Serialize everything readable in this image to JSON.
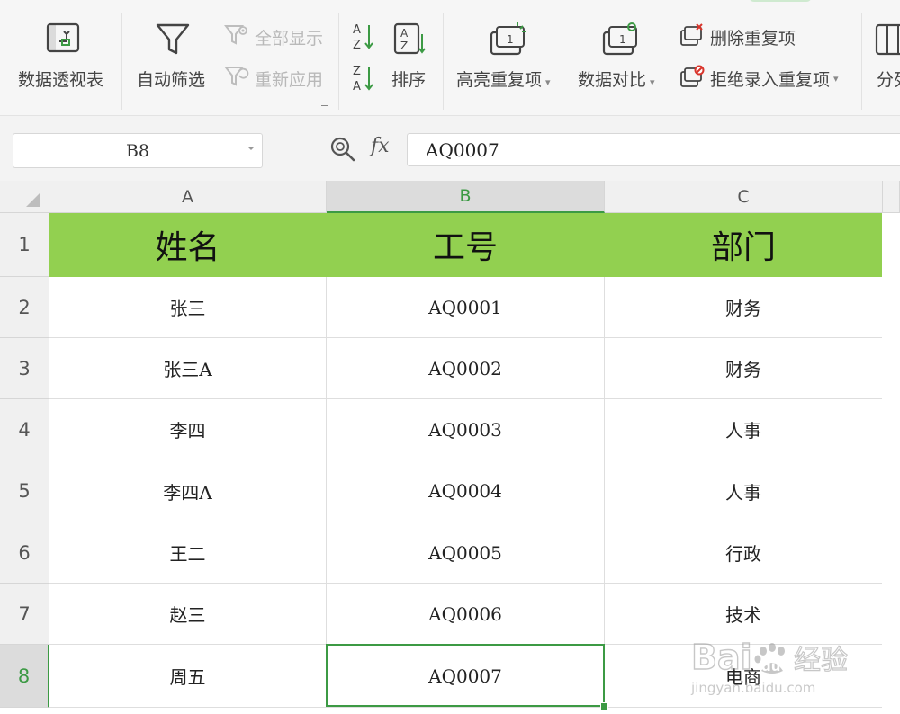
{
  "ribbon": {
    "pivot_table": "数据透视表",
    "auto_filter": "自动筛选",
    "show_all": "全部显示",
    "reapply": "重新应用",
    "sort": "排序",
    "highlight_duplicates": "高亮重复项",
    "data_compare": "数据对比",
    "delete_duplicates": "删除重复项",
    "reject_duplicates": "拒绝录入重复项",
    "split": "分列"
  },
  "formula_bar": {
    "name_box": "B8",
    "fx": "fx",
    "value": "AQ0007"
  },
  "grid": {
    "columns": [
      "A",
      "B",
      "C"
    ],
    "rows": [
      "1",
      "2",
      "3",
      "4",
      "5",
      "6",
      "7",
      "8"
    ],
    "header": {
      "a": "姓名",
      "b": "工号",
      "c": "部门"
    },
    "data": [
      {
        "a": "张三",
        "b": "AQ0001",
        "c": "财务"
      },
      {
        "a": "张三A",
        "b": "AQ0002",
        "c": "财务"
      },
      {
        "a": "李四",
        "b": "AQ0003",
        "c": "人事"
      },
      {
        "a": "李四A",
        "b": "AQ0004",
        "c": "人事"
      },
      {
        "a": "王二",
        "b": "AQ0005",
        "c": "行政"
      },
      {
        "a": "赵三",
        "b": "AQ0006",
        "c": "技术"
      },
      {
        "a": "周五",
        "b": "AQ0007",
        "c": "电商"
      }
    ],
    "selected_cell": "B8"
  },
  "watermark": {
    "brand": "Bai",
    "suffix": "du",
    "cn": "经验",
    "url": "jingyan.baidu.com"
  },
  "colors": {
    "header_fill": "#92d050",
    "accent": "#3c9a44"
  },
  "icons": [
    "pivot-table-icon",
    "funnel-icon",
    "funnel-eye-icon",
    "funnel-refresh-icon",
    "sort-az-icon",
    "sort-za-icon",
    "sort-icon",
    "highlight-duplicates-icon",
    "data-compare-icon",
    "delete-duplicates-icon",
    "reject-duplicates-icon",
    "split-columns-icon",
    "zoom-icon"
  ]
}
